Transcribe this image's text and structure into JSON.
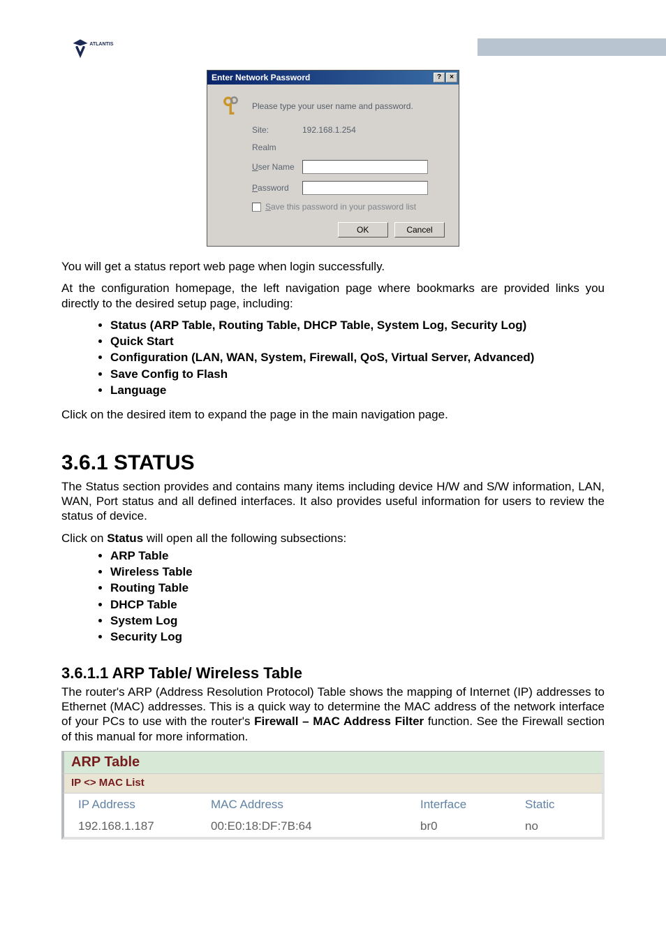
{
  "logo_text": "ATLANTIS",
  "dialog": {
    "title": "Enter Network Password",
    "help_btn": "?",
    "close_btn": "×",
    "prompt": "Please type your user name and password.",
    "site_label": "Site:",
    "site_value": "192.168.1.254",
    "realm_label": "Realm",
    "realm_value": "",
    "user_label_pre": "U",
    "user_label_rest": "ser Name",
    "user_value": "",
    "pass_label_pre": "P",
    "pass_label_rest": "assword",
    "pass_value": "",
    "save_chk_pre": "S",
    "save_chk_rest": "ave this password in your password list",
    "ok": "OK",
    "cancel": "Cancel"
  },
  "body": {
    "p1": "You will get a status report web page when login successfully.",
    "p2": "At the configuration homepage, the left navigation page where bookmarks are provided links you directly to the desired setup page, including:",
    "nav_items": [
      "Status (ARP Table, Routing Table, DHCP Table,  System Log, Security Log)",
      "Quick Start",
      "Configuration (LAN, WAN, System, Firewall, QoS, Virtual Server, Advanced)",
      "Save Config to Flash",
      "Language"
    ],
    "p3": "Click on the desired item to expand the page in the main navigation page."
  },
  "status": {
    "heading": "3.6.1 STATUS",
    "p1": "The Status section provides and contains many items including device H/W and S/W information, LAN, WAN, Port status and all defined interfaces. It also provides useful information for users to review the status of device.",
    "p2_pre": "Click on ",
    "p2_bold": "Status",
    "p2_post": " will open all the following subsections:",
    "items": [
      "ARP Table",
      "Wireless Table",
      "Routing Table",
      "DHCP Table",
      "System Log",
      "Security Log"
    ]
  },
  "arp": {
    "heading": "3.6.1.1 ARP Table/ Wireless Table",
    "p1_pre": "The router's ARP (Address Resolution Protocol) Table shows the mapping of Internet (IP) addresses to Ethernet (MAC) addresses. This is a quick way to determine the MAC address of the network interface of your PCs to use with the router's ",
    "p1_bold": "Firewall – MAC Address Filter",
    "p1_post": " function. See the Firewall section of this manual for more information.",
    "table_title": "ARP Table",
    "table_sub": "IP <> MAC List",
    "headers": {
      "ip": "IP Address",
      "mac": "MAC Address",
      "iface": "Interface",
      "static": "Static"
    },
    "rows": [
      {
        "ip": "192.168.1.187",
        "mac": "00:E0:18:DF:7B:64",
        "iface": "br0",
        "static": "no"
      }
    ]
  }
}
